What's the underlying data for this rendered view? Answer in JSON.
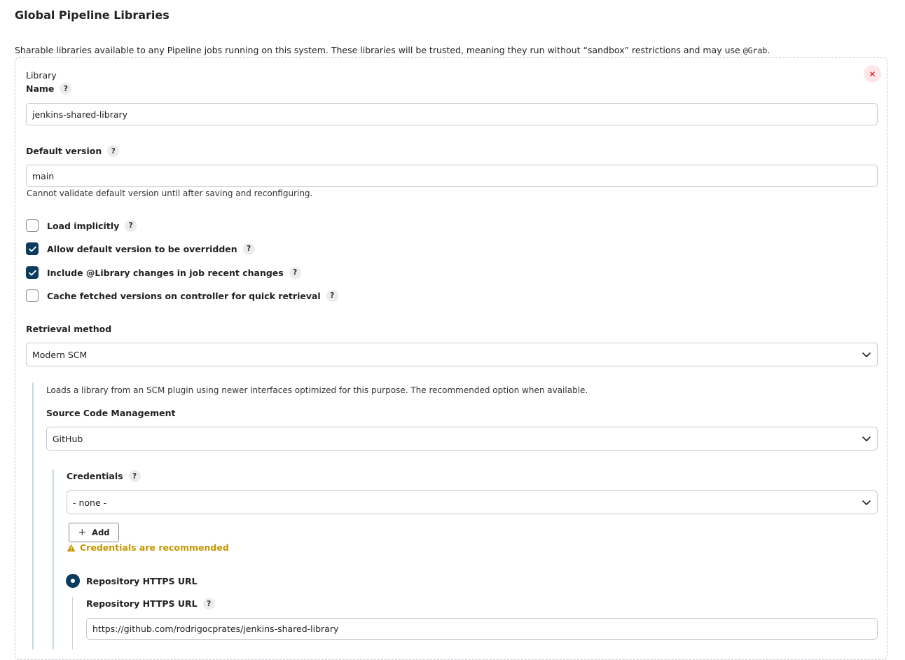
{
  "section": {
    "title": "Global Pipeline Libraries",
    "description_pre": "Sharable libraries available to any Pipeline jobs running on this system. These libraries will be trusted, meaning they run without “sandbox” restrictions and may use ",
    "description_code": "@Grab",
    "description_post": "."
  },
  "library": {
    "heading": "Library",
    "close_label": "✕",
    "name": {
      "label": "Name",
      "value": "jenkins-shared-library"
    },
    "default_version": {
      "label": "Default version",
      "value": "main",
      "note": "Cannot validate default version until after saving and reconfiguring."
    },
    "options": [
      {
        "label": "Load implicitly",
        "checked": false
      },
      {
        "label": "Allow default version to be overridden",
        "checked": true
      },
      {
        "label": "Include @Library changes in job recent changes",
        "checked": true
      },
      {
        "label": "Cache fetched versions on controller for quick retrieval",
        "checked": false
      }
    ],
    "retrieval": {
      "label": "Retrieval method",
      "selected": "Modern SCM",
      "description": "Loads a library from an SCM plugin using newer interfaces optimized for this purpose. The recommended option when available."
    },
    "scm": {
      "label": "Source Code Management",
      "selected": "GitHub"
    },
    "credentials": {
      "label": "Credentials",
      "selected": "- none -",
      "add_label": "Add",
      "warning": "Credentials are recommended"
    },
    "repo": {
      "radio_label": "Repository HTTPS URL",
      "field_label": "Repository HTTPS URL",
      "value": "https://github.com/rodrigocprates/jenkins-shared-library"
    }
  },
  "help_glyph": "?",
  "colors": {
    "accent": "#0b3c5d",
    "warning": "#c79700",
    "danger": "#e6001f"
  }
}
